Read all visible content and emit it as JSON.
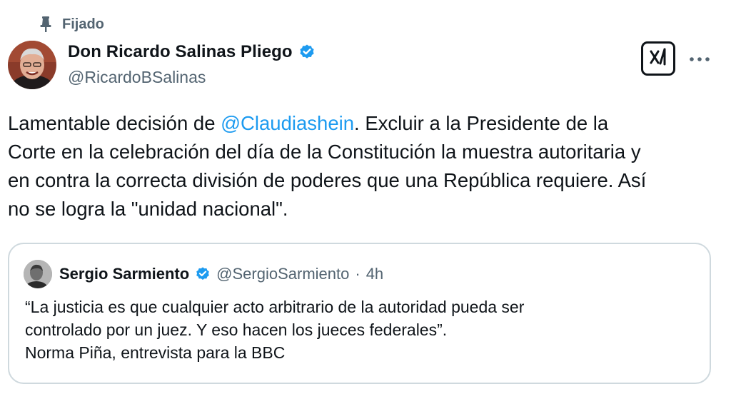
{
  "pinned": {
    "label": "Fijado",
    "icon": "pin-icon"
  },
  "author": {
    "display_name": "Don Ricardo Salinas Pliego",
    "handle": "@RicardoBSalinas",
    "verified_icon": "verified-badge-icon",
    "verified_color": "#1d9bf0"
  },
  "actions": {
    "grok_icon": "grok-icon",
    "more_icon": "more-options-icon"
  },
  "tweet": {
    "line1_pre": "Lamentable decisión de ",
    "mention": "@Claudiashein",
    "line1_post": ". Excluir a la  Presidente de la",
    "line2": "Corte en la celebración del día de la Constitución la muestra autoritaria y",
    "line3": "en contra la correcta división de poderes que una República requiere. Así",
    "line4": "no se logra la \"unidad nacional\"."
  },
  "quote": {
    "display_name": "Sergio Sarmiento",
    "handle": "@SergioSarmiento",
    "separator": "·",
    "time": "4h",
    "line1": "“La justicia es que cualquier acto arbitrario de la autoridad pueda ser",
    "line2": "controlado por un juez. Y eso hacen los jueces federales”.",
    "line3": "Norma Piña, entrevista para la BBC"
  },
  "colors": {
    "text_primary": "#0f1419",
    "text_secondary": "#536471",
    "accent": "#1d9bf0",
    "border": "#cfd9de"
  }
}
